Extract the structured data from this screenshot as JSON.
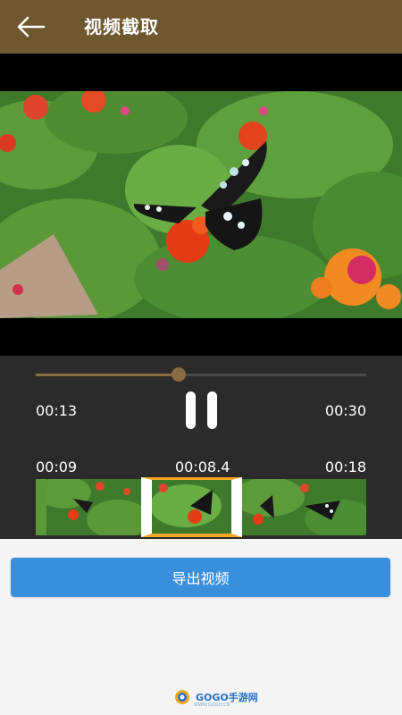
{
  "header": {
    "title": "视频截取"
  },
  "player": {
    "current_time": "00:13",
    "total_time": "00:30",
    "progress": 0.433
  },
  "trim": {
    "start_time": "00:09",
    "duration": "00:08.4",
    "end_time": "00:18"
  },
  "actions": {
    "export_label": "导出视频"
  },
  "watermark": {
    "brand": "GOGO手游网",
    "site": "WWW.GOGO.CN"
  },
  "colors": {
    "header_bg": "#6f5730",
    "seek_accent": "#8a6c43",
    "selection_border": "#f5a623",
    "export_button": "#3a8fdc"
  }
}
